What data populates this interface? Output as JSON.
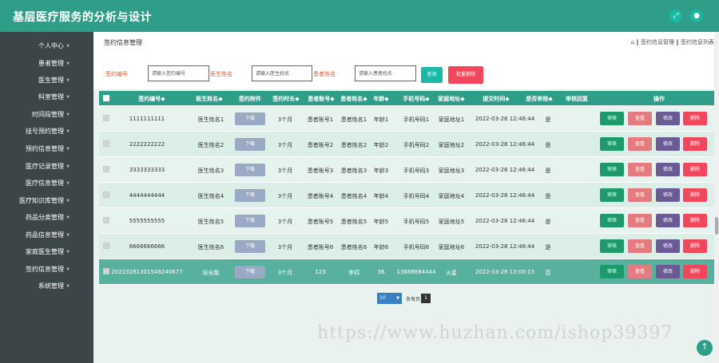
{
  "app": {
    "title": "基层医疗服务的分析与设计"
  },
  "topbar_icons": [
    {
      "name": "fullscreen-icon",
      "glyph": "⤢"
    },
    {
      "name": "user-icon",
      "glyph": "●"
    }
  ],
  "sidebar": {
    "items": [
      {
        "label": "个人中心"
      },
      {
        "label": "患者管理"
      },
      {
        "label": "医生管理"
      },
      {
        "label": "科室管理"
      },
      {
        "label": "时间段管理"
      },
      {
        "label": "挂号预约管理"
      },
      {
        "label": "预约信息管理"
      },
      {
        "label": "医疗记录管理"
      },
      {
        "label": "医疗信息管理"
      },
      {
        "label": "医疗知识库管理"
      },
      {
        "label": "药品分类管理"
      },
      {
        "label": "药品信息管理"
      },
      {
        "label": "家庭医生管理"
      },
      {
        "label": "签约信息管理"
      },
      {
        "label": "系统管理"
      }
    ]
  },
  "page": {
    "title": "签约信息管理",
    "breadcrumb": "⌂ ‖ 签约信息管理 ‖ 签约信息列表"
  },
  "filters": [
    {
      "label": "签约编号",
      "placeholder": "请输入签约编号"
    },
    {
      "label": "医生姓名",
      "placeholder": "请输入医生姓名"
    },
    {
      "label": "患者姓名",
      "placeholder": "请输入患者姓名"
    }
  ],
  "buttons": {
    "search": "查询",
    "batch_delete": "批量删除",
    "download": "下载",
    "audit": "审核",
    "view": "查看",
    "edit": "修改",
    "delete": "删除"
  },
  "colors": {
    "primary": "#2e9e88",
    "audit": "#1d9a6c",
    "view": "#e47b80",
    "edit": "#6b5b95",
    "delete": "#f1475d",
    "search": "#1bb8a5",
    "batch_delete": "#f1475d"
  },
  "table": {
    "headers": [
      "签约编号◆",
      "医生姓名◆",
      "签约附件",
      "签约时长◆",
      "患者账号◆",
      "患者姓名◆",
      "年龄◆",
      "手机号码◆",
      "家庭地址◆",
      "提交时间◆",
      "是否审核◆",
      "审核回复",
      "操作"
    ],
    "rows": [
      {
        "id": "1111111111",
        "doctor": "医生姓名1",
        "duration": "3个月",
        "account": "患者账号1",
        "patient": "患者姓名1",
        "age": "年龄1",
        "phone": "手机号码1",
        "address": "家庭地址1",
        "time": "2022-03-28 12:46:44",
        "audited": "是",
        "reply": ""
      },
      {
        "id": "2222222222",
        "doctor": "医生姓名2",
        "duration": "3个月",
        "account": "患者账号2",
        "patient": "患者姓名2",
        "age": "年龄2",
        "phone": "手机号码2",
        "address": "家庭地址2",
        "time": "2022-03-28 12:46:44",
        "audited": "是",
        "reply": ""
      },
      {
        "id": "3333333333",
        "doctor": "医生姓名3",
        "duration": "3个月",
        "account": "患者账号3",
        "patient": "患者姓名3",
        "age": "年龄3",
        "phone": "手机号码3",
        "address": "家庭地址3",
        "time": "2022-03-28 12:46:44",
        "audited": "是",
        "reply": ""
      },
      {
        "id": "4444444444",
        "doctor": "医生姓名4",
        "duration": "3个月",
        "account": "患者账号4",
        "patient": "患者姓名4",
        "age": "年龄4",
        "phone": "手机号码4",
        "address": "家庭地址4",
        "time": "2022-03-28 12:46:44",
        "audited": "是",
        "reply": ""
      },
      {
        "id": "5555555555",
        "doctor": "医生姓名5",
        "duration": "3个月",
        "account": "患者账号5",
        "patient": "患者姓名5",
        "age": "年龄5",
        "phone": "手机号码5",
        "address": "家庭地址5",
        "time": "2022-03-28 12:46:44",
        "audited": "是",
        "reply": ""
      },
      {
        "id": "6666666666",
        "doctor": "医生姓名6",
        "duration": "3个月",
        "account": "患者账号6",
        "patient": "患者姓名6",
        "age": "年龄6",
        "phone": "手机号码6",
        "address": "家庭地址6",
        "time": "2022-03-28 12:46:44",
        "audited": "是",
        "reply": ""
      },
      {
        "id": "20223281301548240677",
        "doctor": "张全能",
        "duration": "3个月",
        "account": "123",
        "patient": "李四",
        "age": "36",
        "phone": "13688884444",
        "address": "火星",
        "time": "2022-03-28 13:00:15",
        "audited": "否",
        "reply": ""
      }
    ]
  },
  "pagination": {
    "page_size": "10",
    "total_label": "条每页",
    "current_page": "1"
  },
  "watermark": "https://www.huzhan.com/ishop39397"
}
